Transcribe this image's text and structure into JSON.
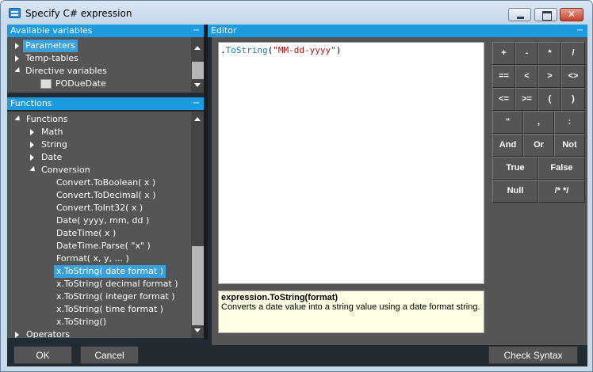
{
  "window": {
    "title": "Specify C# expression",
    "close_glyph": "✕"
  },
  "variables_panel": {
    "header": "Available variables",
    "items": [
      {
        "label": "Parameters",
        "expanded": false,
        "selected": true
      },
      {
        "label": "Temp-tables",
        "expanded": false,
        "selected": false
      },
      {
        "label": "Directive variables",
        "expanded": true,
        "selected": false
      },
      {
        "label": "PODueDate",
        "child": true,
        "icon": "table-variable-icon"
      }
    ]
  },
  "functions_panel": {
    "header": "Functions",
    "items": [
      {
        "label": "Functions",
        "level": 0,
        "state": "expanded"
      },
      {
        "label": "Math",
        "level": 1,
        "state": "collapsed"
      },
      {
        "label": "String",
        "level": 1,
        "state": "collapsed"
      },
      {
        "label": "Date",
        "level": 1,
        "state": "collapsed"
      },
      {
        "label": "Conversion",
        "level": 1,
        "state": "expanded"
      },
      {
        "label": "Convert.ToBoolean( x )",
        "level": 2
      },
      {
        "label": "Convert.ToDecimal( x )",
        "level": 2
      },
      {
        "label": "Convert.ToInt32( x )",
        "level": 2
      },
      {
        "label": "Date( yyyy, mm, dd )",
        "level": 2
      },
      {
        "label": "DateTime( x )",
        "level": 2
      },
      {
        "label": "DateTime.Parse( \"x\" )",
        "level": 2
      },
      {
        "label": "Format( x, y, ... )",
        "level": 2
      },
      {
        "label": "x.ToString( date format )",
        "level": 2,
        "selected": true
      },
      {
        "label": "x.ToString( decimal format )",
        "level": 2
      },
      {
        "label": "x.ToString( integer format )",
        "level": 2
      },
      {
        "label": "x.ToString( time format )",
        "level": 2
      },
      {
        "label": "x.ToString()",
        "level": 2
      },
      {
        "label": "Operators",
        "level": 0,
        "state": "collapsed"
      }
    ]
  },
  "editor": {
    "header": "Editor",
    "code_dot": ".",
    "code_method": "ToString",
    "code_open": "(",
    "code_string": "\"MM-dd-yyyy\"",
    "code_close": ")",
    "help_title": "expression.ToString(format)",
    "help_text": "Converts a date value into a string value using a date format string."
  },
  "calculator": {
    "buttons": [
      "+",
      "-",
      "*",
      "/",
      "==",
      "<",
      ">",
      "<>",
      "<=",
      ">=",
      "(",
      ")",
      "\"",
      ",",
      ":",
      "And",
      "Or",
      "Not",
      "True",
      "False",
      "Null",
      "/* */"
    ]
  },
  "footer": {
    "ok_label": "OK",
    "cancel_label": "Cancel",
    "check_syntax_label": "Check Syntax"
  },
  "colors": {
    "header_blue": "#1d9be0",
    "panel_gray": "#555555",
    "selection": "#3aa0dc"
  }
}
